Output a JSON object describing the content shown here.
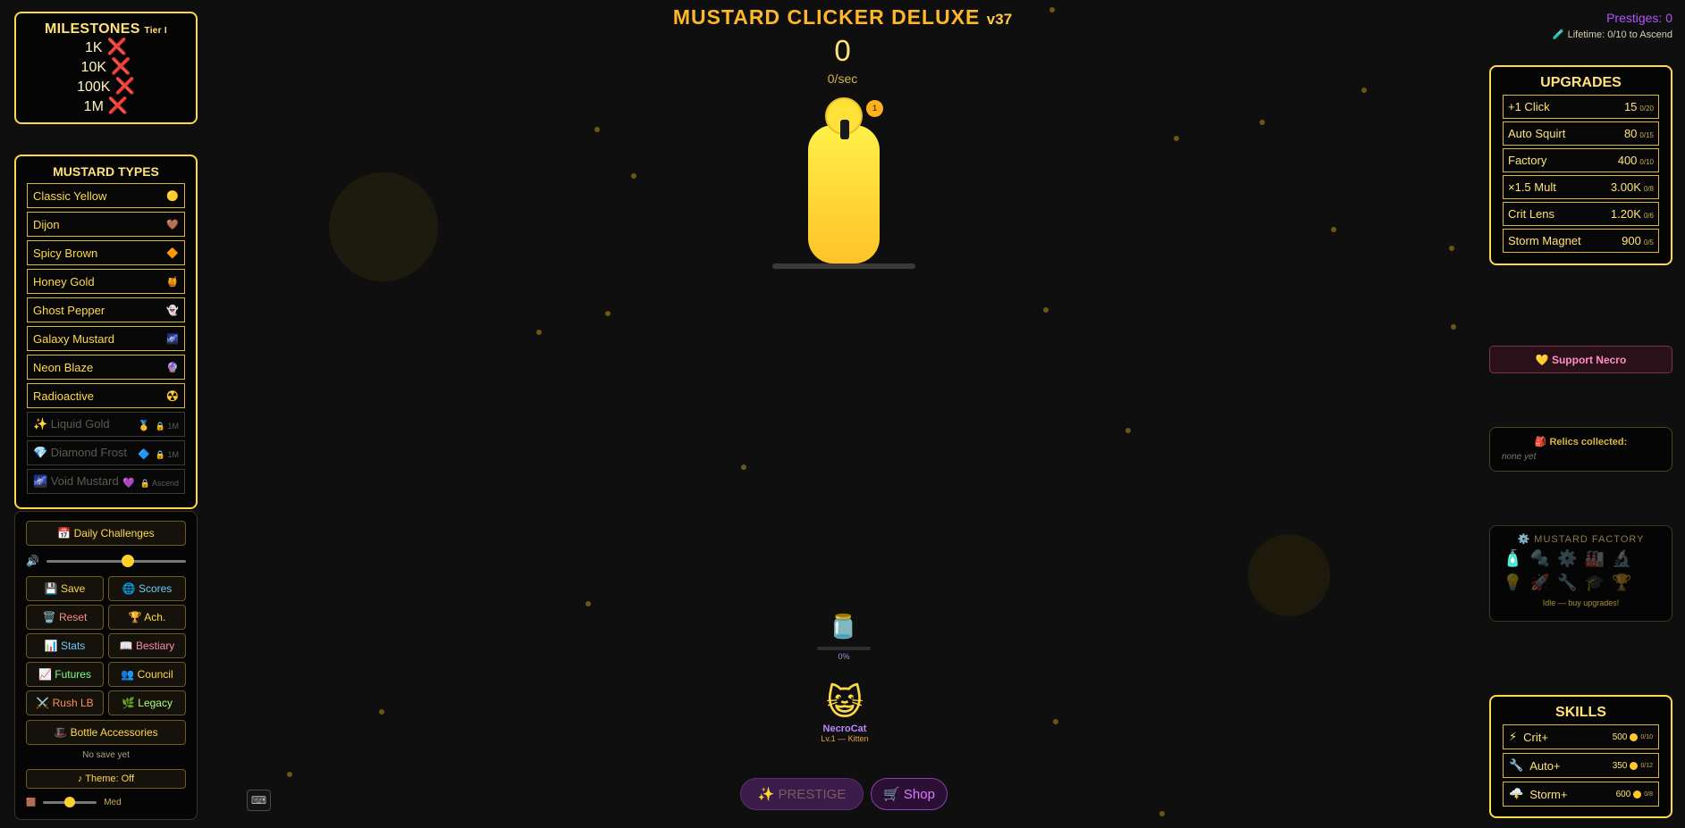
{
  "game": {
    "title": "MUSTARD CLICKER DELUXE",
    "version": "v37",
    "count": "0",
    "rate": "0/sec",
    "bottle_badge": "1"
  },
  "milestones": {
    "title": "MILESTONES",
    "tier": "Tier I",
    "items": [
      {
        "label": "1K",
        "status": "❌"
      },
      {
        "label": "10K",
        "status": "❌"
      },
      {
        "label": "100K",
        "status": "❌"
      },
      {
        "label": "1M",
        "status": "❌"
      }
    ]
  },
  "mustard_types": {
    "title": "MUSTARD TYPES",
    "items": [
      {
        "label": "Classic Yellow",
        "icon": "🟡"
      },
      {
        "label": "Dijon",
        "icon": "🤎"
      },
      {
        "label": "Spicy Brown",
        "icon": "🔶"
      },
      {
        "label": "Honey Gold",
        "icon": "🍯"
      },
      {
        "label": "Ghost Pepper",
        "icon": "👻"
      },
      {
        "label": "Galaxy Mustard",
        "icon": "🌌"
      },
      {
        "label": "Neon Blaze",
        "icon": "🔮"
      },
      {
        "label": "Radioactive",
        "icon": "☢️"
      },
      {
        "label": "✨ Liquid Gold",
        "icon": "🥇",
        "lock": "🔒 1M"
      },
      {
        "label": "💎 Diamond Frost",
        "icon": "🔷",
        "lock": "🔒 1M"
      },
      {
        "label": "🌌 Void Mustard",
        "icon": "💜",
        "lock": "🔒 Ascend"
      }
    ]
  },
  "tools": {
    "daily_challenges": "📅 Daily Challenges",
    "volume_icon": "🔊",
    "volume_level": 0.6,
    "buttons": [
      {
        "label": "💾 Save",
        "color": "#ffd84a"
      },
      {
        "label": "🌐 Scores",
        "color": "#6ec8ff"
      },
      {
        "label": "🗑️ Reset",
        "color": "#ff8a8a"
      },
      {
        "label": "🏆 Ach.",
        "color": "#ffd84a"
      },
      {
        "label": "📊 Stats",
        "color": "#6ec8ff"
      },
      {
        "label": "📖 Bestiary",
        "color": "#ff8aa8"
      },
      {
        "label": "📈 Futures",
        "color": "#7cff8a"
      },
      {
        "label": "👥 Council",
        "color": "#ffd84a"
      },
      {
        "label": "⚔️ Rush LB",
        "color": "#ff8a5a"
      },
      {
        "label": "🌿 Legacy",
        "color": "#aaff7a"
      }
    ],
    "bottle_accessories": "🎩 Bottle Accessories",
    "save_status": "No save yet",
    "theme": "♪ Theme: Off",
    "speed_icon": "🟫",
    "speed_level": 0.5,
    "speed_label": "Med"
  },
  "center": {
    "jar_icon": "🫙",
    "jar_progress": "0%",
    "pet": {
      "face": "😺",
      "name": "NecroCat",
      "level": "Lv.1 — Kitten"
    },
    "prestige": "✨ PRESTIGE",
    "shop": "🛒 Shop",
    "keyboard_icon": "⌨"
  },
  "status": {
    "prestiges": "Prestiges: 0",
    "lifetime": "🧪 Lifetime: 0/10 to Ascend"
  },
  "upgrades": {
    "title": "UPGRADES",
    "items": [
      {
        "label": "+1 Click",
        "cost": "15",
        "count": "0/20"
      },
      {
        "label": "Auto Squirt",
        "cost": "80",
        "count": "0/15"
      },
      {
        "label": "Factory",
        "cost": "400",
        "count": "0/10"
      },
      {
        "label": "×1.5 Mult",
        "cost": "3.00K",
        "count": "0/8"
      },
      {
        "label": "Crit Lens",
        "cost": "1.20K",
        "count": "0/6"
      },
      {
        "label": "Storm Magnet",
        "cost": "900",
        "count": "0/5"
      }
    ]
  },
  "support": "💛 Support Necro",
  "relics": {
    "title": "🎒 Relics collected:",
    "value": "none yet"
  },
  "factory": {
    "title": "⚙️ MUSTARD FACTORY",
    "icons": [
      "🧴",
      "🔩",
      "⚙️",
      "🏭",
      "🔬",
      "💡",
      "🚀",
      "🔧",
      "🎓",
      "🏆"
    ],
    "status": "Idle — buy upgrades!"
  },
  "skills": {
    "title": "SKILLS",
    "items": [
      {
        "icon": "⚡",
        "label": "Crit+",
        "cost": "500",
        "count": "0/10"
      },
      {
        "icon": "🔧",
        "label": "Auto+",
        "cost": "350",
        "count": "0/12"
      },
      {
        "icon": "🌩️",
        "label": "Storm+",
        "cost": "600",
        "count": "0/8"
      }
    ]
  }
}
